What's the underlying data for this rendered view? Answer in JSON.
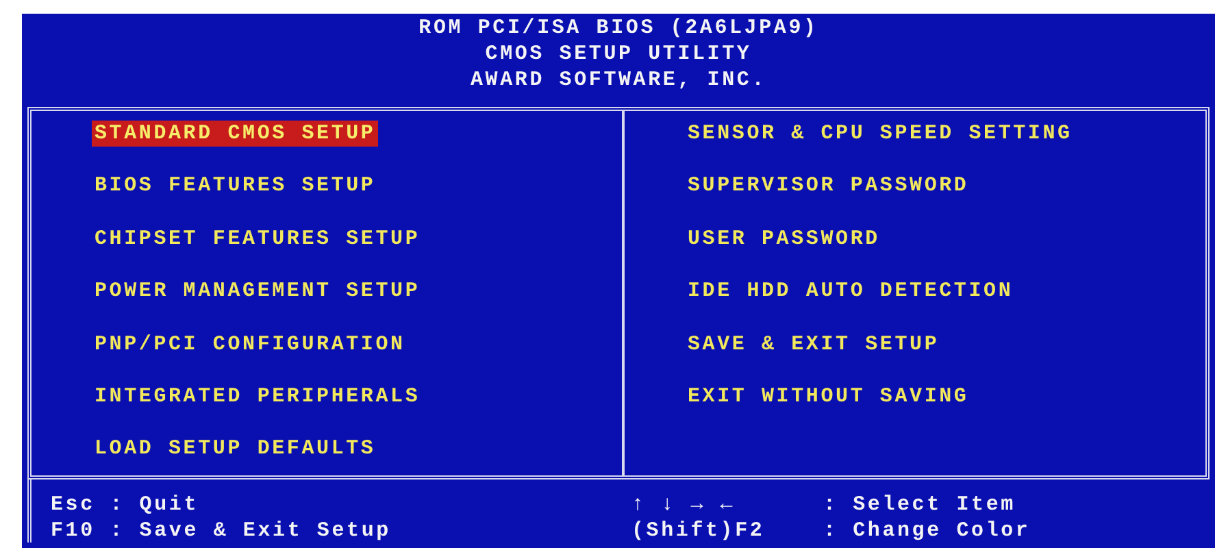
{
  "header": {
    "lines": [
      "ROM PCI/ISA BIOS (2A6LJPA9)",
      "CMOS SETUP UTILITY",
      "AWARD SOFTWARE, INC."
    ]
  },
  "menu": {
    "columns": [
      {
        "items": [
          {
            "label": "STANDARD CMOS SETUP",
            "selected": true
          },
          {
            "label": "BIOS FEATURES SETUP",
            "selected": false
          },
          {
            "label": "CHIPSET FEATURES SETUP",
            "selected": false
          },
          {
            "label": "POWER MANAGEMENT SETUP",
            "selected": false
          },
          {
            "label": "PNP/PCI CONFIGURATION",
            "selected": false
          },
          {
            "label": "INTEGRATED PERIPHERALS",
            "selected": false
          },
          {
            "label": "LOAD SETUP DEFAULTS",
            "selected": false
          }
        ]
      },
      {
        "items": [
          {
            "label": "SENSOR & CPU SPEED SETTING",
            "selected": false
          },
          {
            "label": "SUPERVISOR PASSWORD",
            "selected": false
          },
          {
            "label": "USER PASSWORD",
            "selected": false
          },
          {
            "label": "IDE HDD AUTO DETECTION",
            "selected": false
          },
          {
            "label": "SAVE & EXIT SETUP",
            "selected": false
          },
          {
            "label": "EXIT WITHOUT SAVING",
            "selected": false
          }
        ]
      }
    ]
  },
  "footer": {
    "left": [
      {
        "text": "Esc : Quit"
      },
      {
        "text": "F10 : Save & Exit Setup"
      }
    ],
    "right": [
      {
        "key": "↑ ↓ → ←",
        "action": ": Select Item"
      },
      {
        "key": "(Shift)F2",
        "action": ": Change Color"
      }
    ]
  }
}
